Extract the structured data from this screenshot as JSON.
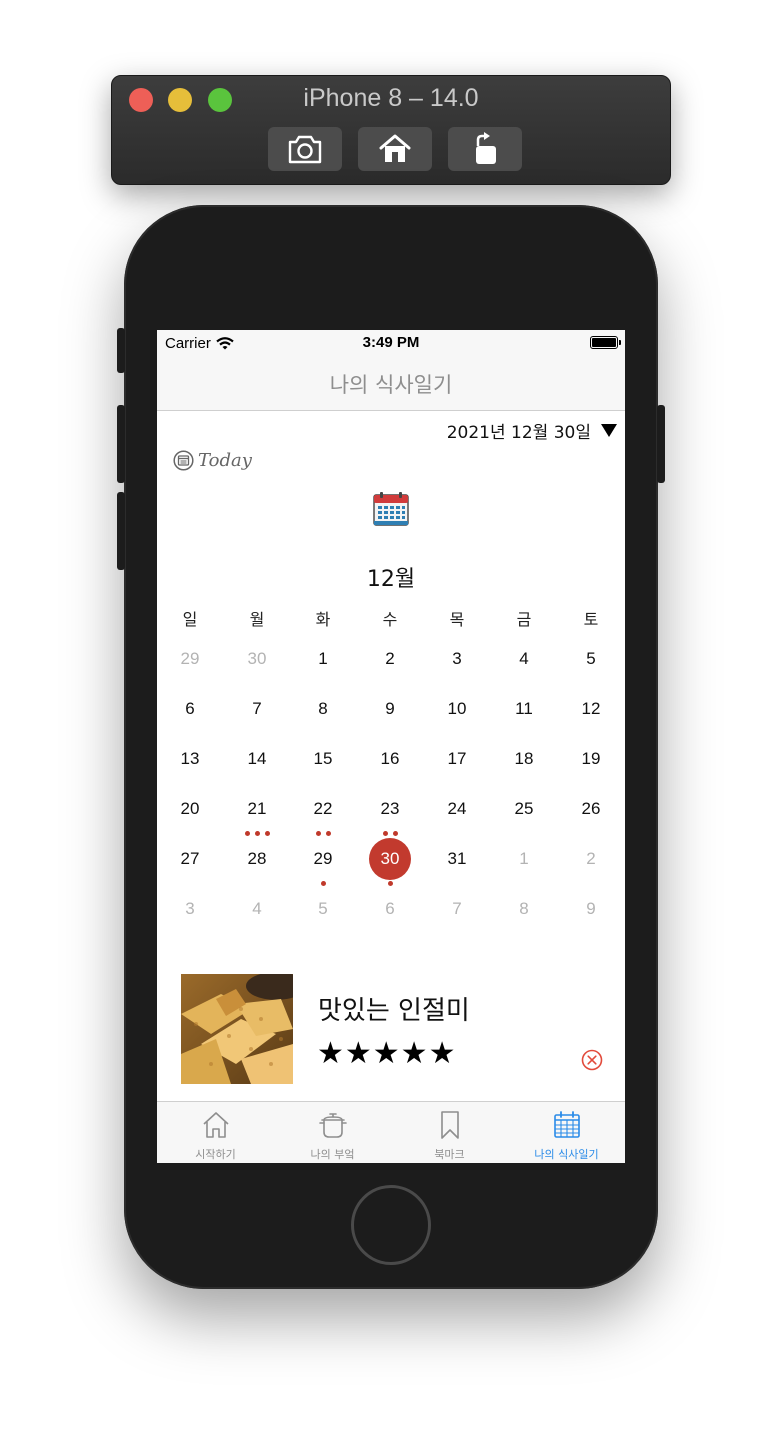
{
  "simulator": {
    "title": "iPhone 8 – 14.0"
  },
  "status_bar": {
    "carrier": "Carrier",
    "time": "3:49 PM"
  },
  "nav": {
    "title": "나의 식사일기"
  },
  "date_picker": {
    "value": "2021년 12월 30일"
  },
  "today_button": {
    "label": "Today"
  },
  "calendar": {
    "month_title": "12월",
    "weekdays": [
      "일",
      "월",
      "화",
      "수",
      "목",
      "금",
      "토"
    ],
    "weeks": [
      [
        {
          "d": "29",
          "muted": true
        },
        {
          "d": "30",
          "muted": true
        },
        {
          "d": "1"
        },
        {
          "d": "2"
        },
        {
          "d": "3"
        },
        {
          "d": "4"
        },
        {
          "d": "5"
        }
      ],
      [
        {
          "d": "6"
        },
        {
          "d": "7"
        },
        {
          "d": "8"
        },
        {
          "d": "9"
        },
        {
          "d": "10"
        },
        {
          "d": "11"
        },
        {
          "d": "12"
        }
      ],
      [
        {
          "d": "13"
        },
        {
          "d": "14"
        },
        {
          "d": "15"
        },
        {
          "d": "16"
        },
        {
          "d": "17"
        },
        {
          "d": "18"
        },
        {
          "d": "19"
        }
      ],
      [
        {
          "d": "20"
        },
        {
          "d": "21",
          "dots": 3
        },
        {
          "d": "22",
          "dots": 2
        },
        {
          "d": "23",
          "dots": 2
        },
        {
          "d": "24"
        },
        {
          "d": "25"
        },
        {
          "d": "26"
        }
      ],
      [
        {
          "d": "27"
        },
        {
          "d": "28"
        },
        {
          "d": "29",
          "dots": 1
        },
        {
          "d": "30",
          "selected": true,
          "dots": 1
        },
        {
          "d": "31"
        },
        {
          "d": "1",
          "muted": true
        },
        {
          "d": "2",
          "muted": true
        }
      ],
      [
        {
          "d": "3",
          "muted": true
        },
        {
          "d": "4",
          "muted": true
        },
        {
          "d": "5",
          "muted": true
        },
        {
          "d": "6",
          "muted": true
        },
        {
          "d": "7",
          "muted": true
        },
        {
          "d": "8",
          "muted": true
        },
        {
          "d": "9",
          "muted": true
        }
      ]
    ],
    "dot_color": "#c0392b",
    "selected_color": "#c23a2e"
  },
  "meal": {
    "name": "맛있는 인절미",
    "rating_text": "★★★★★",
    "rating": 5
  },
  "tab_bar": {
    "tabs": [
      {
        "label": "시작하기",
        "icon": "home-icon",
        "active": false
      },
      {
        "label": "나의 부엌",
        "icon": "pot-icon",
        "active": false
      },
      {
        "label": "북마크",
        "icon": "bookmark-icon",
        "active": false
      },
      {
        "label": "나의 식사일기",
        "icon": "calendar-icon",
        "active": true
      }
    ],
    "active_color": "#2a8be8"
  }
}
